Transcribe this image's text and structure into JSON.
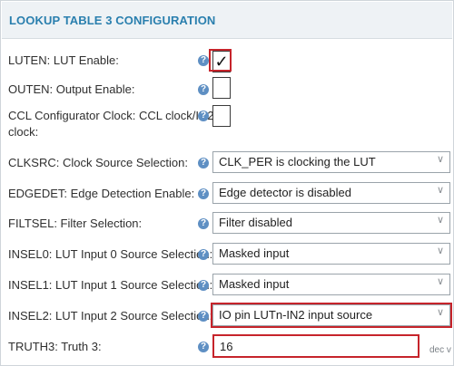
{
  "panel": {
    "title": "LOOKUP TABLE 3 CONFIGURATION"
  },
  "help_icon": "?",
  "rows": [
    {
      "label": "LUTEN: LUT Enable:",
      "control": "checkbox",
      "checked": true,
      "check_mark": "✓"
    },
    {
      "label": "OUTEN: Output Enable:",
      "control": "checkbox",
      "checked": false
    },
    {
      "label_line1": "CCL Configurator Clock: CCL clock/IN2",
      "label_line2": "clock:",
      "control": "checkbox",
      "checked": false
    },
    {
      "label": "CLKSRC: Clock Source Selection:",
      "control": "select",
      "value": "CLK_PER is clocking the LUT"
    },
    {
      "label": "EDGEDET: Edge Detection Enable:",
      "control": "select",
      "value": "Edge detector is disabled"
    },
    {
      "label": "FILTSEL: Filter Selection:",
      "control": "select",
      "value": "Filter disabled"
    },
    {
      "label": "INSEL0: LUT Input 0 Source Selection:",
      "control": "select",
      "value": "Masked input"
    },
    {
      "label": "INSEL1: LUT Input 1 Source Selection:",
      "control": "select",
      "value": "Masked input"
    },
    {
      "label": "INSEL2: LUT Input 2 Source Selection:",
      "control": "select",
      "value": "IO pin LUTn-IN2 input source"
    },
    {
      "label": "TRUTH3: Truth 3:",
      "control": "input",
      "value": "16",
      "unit": "dec v"
    }
  ],
  "caret": "∨",
  "colors": {
    "title": "#2a7fae",
    "help_icon": "#5e8fc3",
    "highlight": "#c6242b",
    "header_bg": "#eef2f5"
  }
}
